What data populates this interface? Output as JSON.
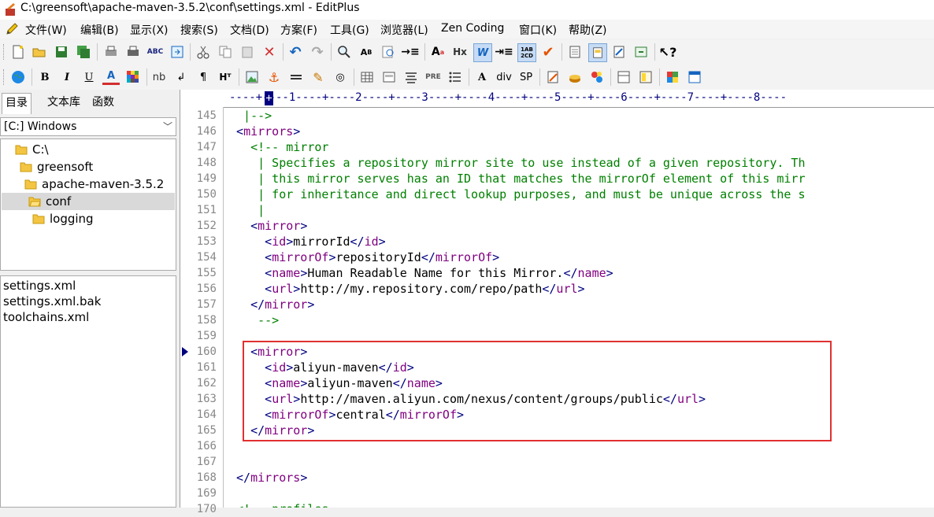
{
  "window": {
    "title": "C:\\greensoft\\apache-maven-3.5.2\\conf\\settings.xml - EditPlus"
  },
  "menu": [
    "文件(W)",
    "编辑(B)",
    "显示(X)",
    "搜索(S)",
    "文档(D)",
    "方案(F)",
    "工具(G)",
    "浏览器(L)",
    "Zen Coding",
    "窗口(K)",
    "帮助(Z)"
  ],
  "toolbar2_text": {
    "bold": "B",
    "italic": "I",
    "underline": "U",
    "font_color": "A",
    "nbsp": "nb",
    "hx": "Hᵀ",
    "pre": "PRE",
    "div": "div",
    "sp": "SP",
    "hx1": "Hx"
  },
  "sidebar": {
    "tabs": [
      "目录",
      "文本库",
      "函数"
    ],
    "drive": "[C:] Windows",
    "tree": [
      "C:\\",
      "greensoft",
      "apache-maven-3.5.2",
      "conf",
      "logging"
    ],
    "files": [
      "settings.xml",
      "settings.xml.bak",
      "toolchains.xml"
    ]
  },
  "editor": {
    "ruler": "----+----1----+----2----+----3----+----4----+----5----+----6----+----7----+----8----",
    "lines": [
      {
        "n": "145",
        "t": "  |-->"
      },
      {
        "n": "146",
        "t": " <mirrors>"
      },
      {
        "n": "147",
        "t": "   <!-- mirror"
      },
      {
        "n": "148",
        "t": "    | Specifies a repository mirror site to use instead of a given repository. Th"
      },
      {
        "n": "149",
        "t": "    | this mirror serves has an ID that matches the mirrorOf element of this mirr"
      },
      {
        "n": "150",
        "t": "    | for inheritance and direct lookup purposes, and must be unique across the s"
      },
      {
        "n": "151",
        "t": "    |"
      },
      {
        "n": "152",
        "t": "   <mirror>"
      },
      {
        "n": "153",
        "t": "     <id>mirrorId</id>"
      },
      {
        "n": "154",
        "t": "     <mirrorOf>repositoryId</mirrorOf>"
      },
      {
        "n": "155",
        "t": "     <name>Human Readable Name for this Mirror.</name>"
      },
      {
        "n": "156",
        "t": "     <url>http://my.repository.com/repo/path</url>"
      },
      {
        "n": "157",
        "t": "   </mirror>"
      },
      {
        "n": "158",
        "t": "    -->"
      },
      {
        "n": "159",
        "t": ""
      },
      {
        "n": "160",
        "t": "   <mirror>"
      },
      {
        "n": "161",
        "t": "     <id>aliyun-maven</id>"
      },
      {
        "n": "162",
        "t": "     <name>aliyun-maven</name>"
      },
      {
        "n": "163",
        "t": "     <url>http://maven.aliyun.com/nexus/content/groups/public</url>"
      },
      {
        "n": "164",
        "t": "     <mirrorOf>central</mirrorOf>"
      },
      {
        "n": "165",
        "t": "   </mirror>"
      },
      {
        "n": "166",
        "t": ""
      },
      {
        "n": "167",
        "t": ""
      },
      {
        "n": "168",
        "t": " </mirrors>"
      },
      {
        "n": "169",
        "t": ""
      },
      {
        "n": "170",
        "t": " <!-- profiles"
      }
    ]
  },
  "colors": {
    "tag": "#000080",
    "tag_name": "#800080",
    "comment": "#008000",
    "highlight": "#e03030"
  }
}
